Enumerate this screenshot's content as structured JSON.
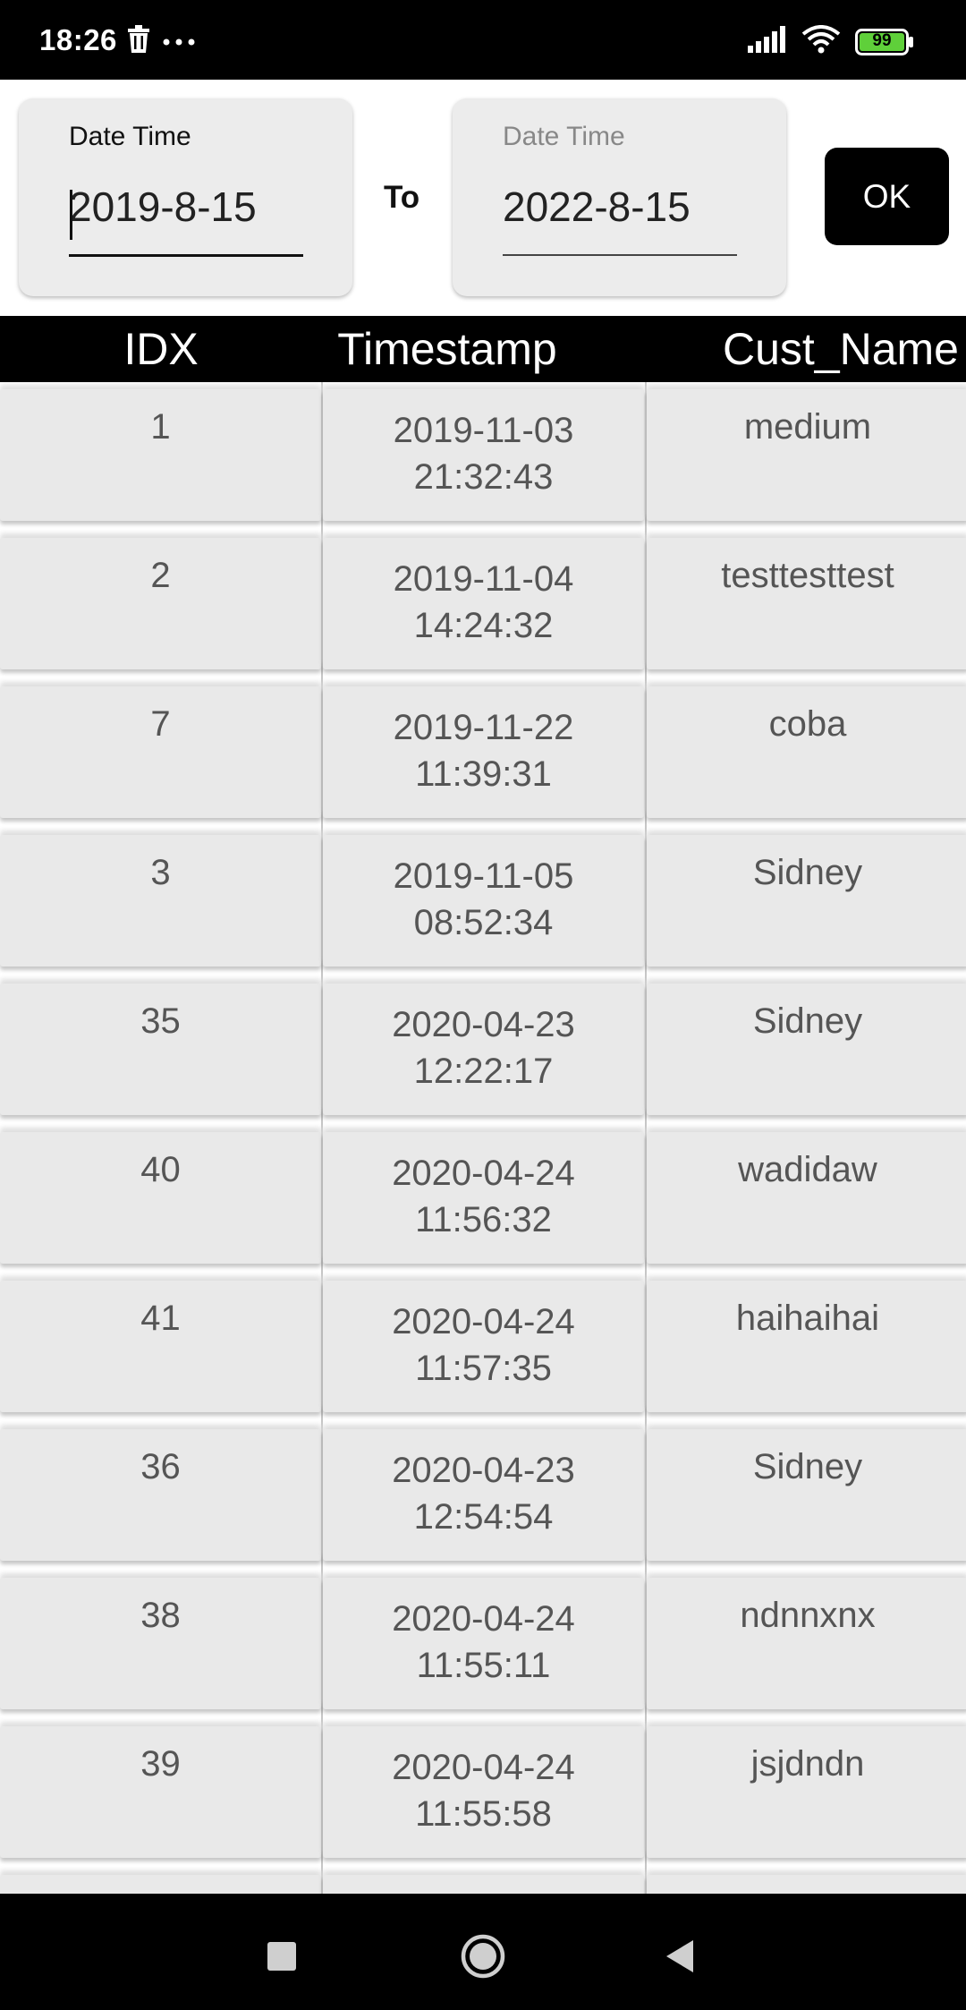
{
  "status_bar": {
    "time": "18:26",
    "battery_level": "99",
    "icons": [
      "trash-icon",
      "more-icon",
      "signal-icon",
      "wifi-icon",
      "battery-icon"
    ]
  },
  "filter": {
    "from": {
      "label": "Date Time",
      "value": "2019-8-15"
    },
    "separator": "To",
    "to": {
      "label": "Date Time",
      "value": "2022-8-15"
    },
    "ok_label": "OK"
  },
  "table": {
    "headers": [
      "IDX",
      "Timestamp",
      "Cust_Name"
    ],
    "rows": [
      {
        "idx": "1",
        "date": "2019-11-03",
        "time": "21:32:43",
        "name": "medium"
      },
      {
        "idx": "2",
        "date": "2019-11-04",
        "time": "14:24:32",
        "name": "testtesttest"
      },
      {
        "idx": "7",
        "date": "2019-11-22",
        "time": "11:39:31",
        "name": "coba"
      },
      {
        "idx": "3",
        "date": "2019-11-05",
        "time": "08:52:34",
        "name": "Sidney"
      },
      {
        "idx": "35",
        "date": "2020-04-23",
        "time": "12:22:17",
        "name": "Sidney"
      },
      {
        "idx": "40",
        "date": "2020-04-24",
        "time": "11:56:32",
        "name": "wadidaw"
      },
      {
        "idx": "41",
        "date": "2020-04-24",
        "time": "11:57:35",
        "name": "haihaihai"
      },
      {
        "idx": "36",
        "date": "2020-04-23",
        "time": "12:54:54",
        "name": "Sidney"
      },
      {
        "idx": "38",
        "date": "2020-04-24",
        "time": "11:55:11",
        "name": "ndnnxnx"
      },
      {
        "idx": "39",
        "date": "2020-04-24",
        "time": "11:55:58",
        "name": "jsjdndn"
      }
    ]
  },
  "nav_bar": {
    "buttons": [
      "recent-apps-icon",
      "home-icon",
      "back-icon"
    ]
  },
  "colors": {
    "header_bg": "#000000",
    "cell_bg": "#e9e9e9",
    "cell_text": "#555555",
    "card_bg": "#ececec"
  }
}
